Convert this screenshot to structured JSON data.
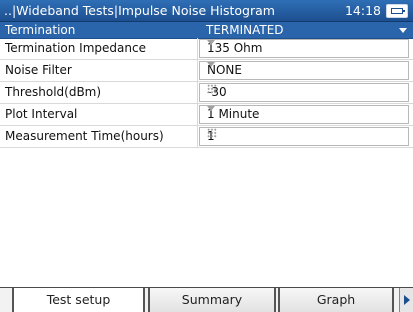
{
  "titlebar": {
    "title": "..|Wideband Tests|Impulse Noise Histogram",
    "time": "14:18",
    "status_icon": "battery-icon"
  },
  "header_row": {
    "label": "Termination",
    "value": "TERMINATED"
  },
  "settings": [
    {
      "label": "Termination Impedance",
      "value": "135 Ohm",
      "control": "dropdown"
    },
    {
      "label": "Noise Filter",
      "value": "NONE",
      "control": "dropdown"
    },
    {
      "label": "Threshold(dBm)",
      "value": "-30",
      "control": "keypad"
    },
    {
      "label": "Plot Interval",
      "value": "1 Minute",
      "control": "dropdown"
    },
    {
      "label": "Measurement Time(hours)",
      "value": "1",
      "control": "keypad"
    }
  ],
  "tabs": [
    {
      "label": "Test setup",
      "active": true
    },
    {
      "label": "Summary",
      "active": false
    },
    {
      "label": "Graph",
      "active": false
    }
  ],
  "colors": {
    "accent": "#2a64aa",
    "titlebar": "#1d4f8f"
  }
}
